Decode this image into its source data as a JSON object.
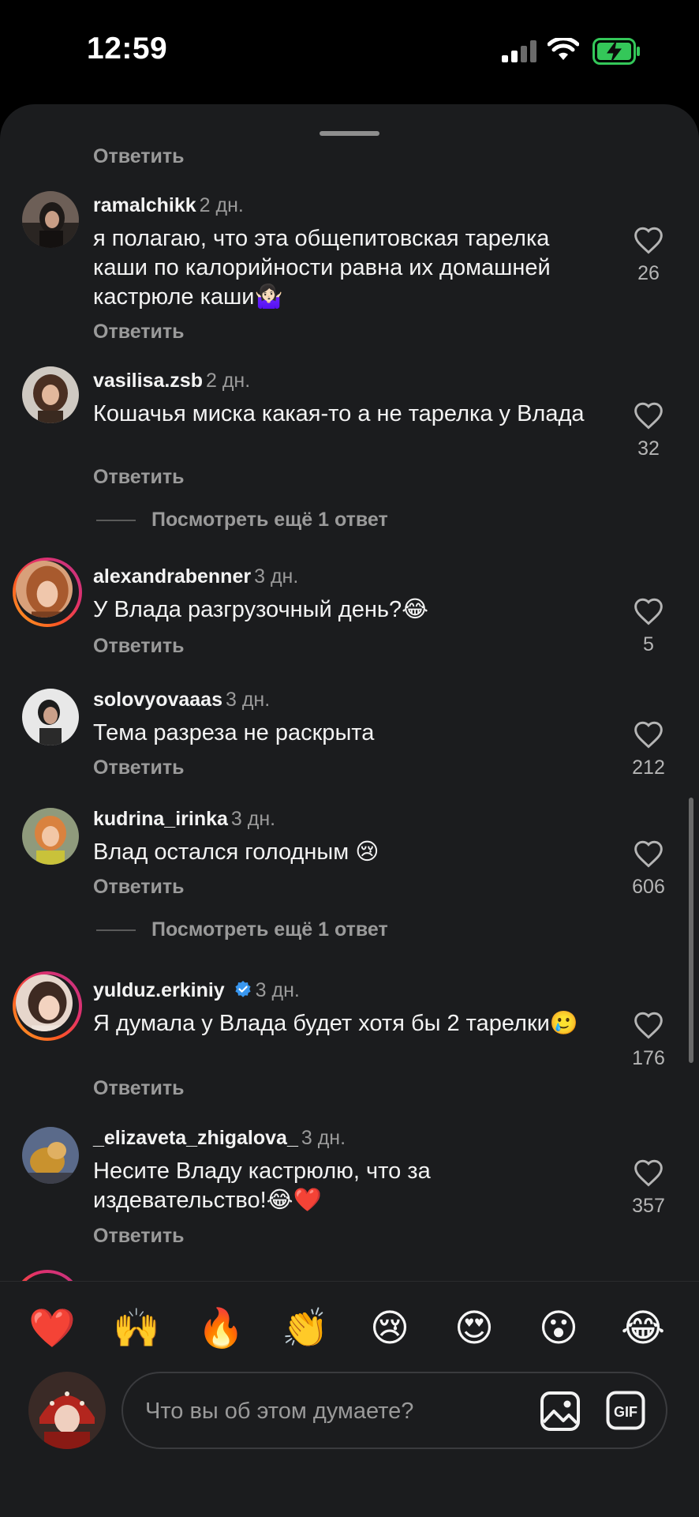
{
  "status_bar": {
    "time": "12:59"
  },
  "sheet": {
    "top_reply_label": "Ответить",
    "comments": [
      {
        "username": "ramalchikk",
        "age": "2 дн.",
        "text": "я полагаю, что эта общепитовская тарелка каши по калорийности равна их домашней кастрюле каши🤷🏻‍♀️",
        "likes": "26",
        "reply_label": "Ответить",
        "verified": false,
        "story_ring": false
      },
      {
        "username": "vasilisa.zsb",
        "age": "2 дн.",
        "text": "Кошачья миска какая-то а не тарелка у Влада",
        "likes": "32",
        "reply_label": "Ответить",
        "verified": false,
        "story_ring": false,
        "more_replies": "Посмотреть ещё 1 ответ"
      },
      {
        "username": "alexandrabenner",
        "age": "3 дн.",
        "text": "У Влада разгрузочный день?😂",
        "likes": "5",
        "reply_label": "Ответить",
        "verified": false,
        "story_ring": true
      },
      {
        "username": "solovyovaaas",
        "age": "3 дн.",
        "text": "Тема разреза не раскрыта",
        "likes": "212",
        "reply_label": "Ответить",
        "verified": false,
        "story_ring": false
      },
      {
        "username": "kudrina_irinka",
        "age": "3 дн.",
        "text": "Влад остался голодным 😢",
        "likes": "606",
        "reply_label": "Ответить",
        "verified": false,
        "story_ring": false,
        "more_replies": "Посмотреть ещё 1 ответ"
      },
      {
        "username": "yulduz.erkiniy",
        "age": "3 дн.",
        "text": "Я думала у Влада будет хотя бы 2 тарелки🥲",
        "likes": "176",
        "reply_label": "Ответить",
        "verified": true,
        "story_ring": true
      },
      {
        "username": "_elizaveta_zhigalova_",
        "age": "3 дн.",
        "text": "Несите Владу кастрюлю, что за издевательство!😂❤️",
        "likes": "357",
        "reply_label": "Ответить",
        "verified": false,
        "story_ring": false
      }
    ]
  },
  "quick_reactions": [
    "❤️",
    "🙌",
    "🔥",
    "👏",
    "😢",
    "😍",
    "😮",
    "😂"
  ],
  "composer": {
    "placeholder": "Что вы об этом думаете?",
    "gif_label": "GIF"
  },
  "colors": {
    "sheet_bg": "#1b1c1e",
    "secondary_text": "#9a9a9a",
    "verified_blue": "#3897f0",
    "battery_green": "#34c759"
  },
  "icons": [
    "signal-icon",
    "wifi-icon",
    "battery-charging-icon",
    "heart-icon",
    "verified-badge-icon",
    "image-icon",
    "gif-icon"
  ]
}
